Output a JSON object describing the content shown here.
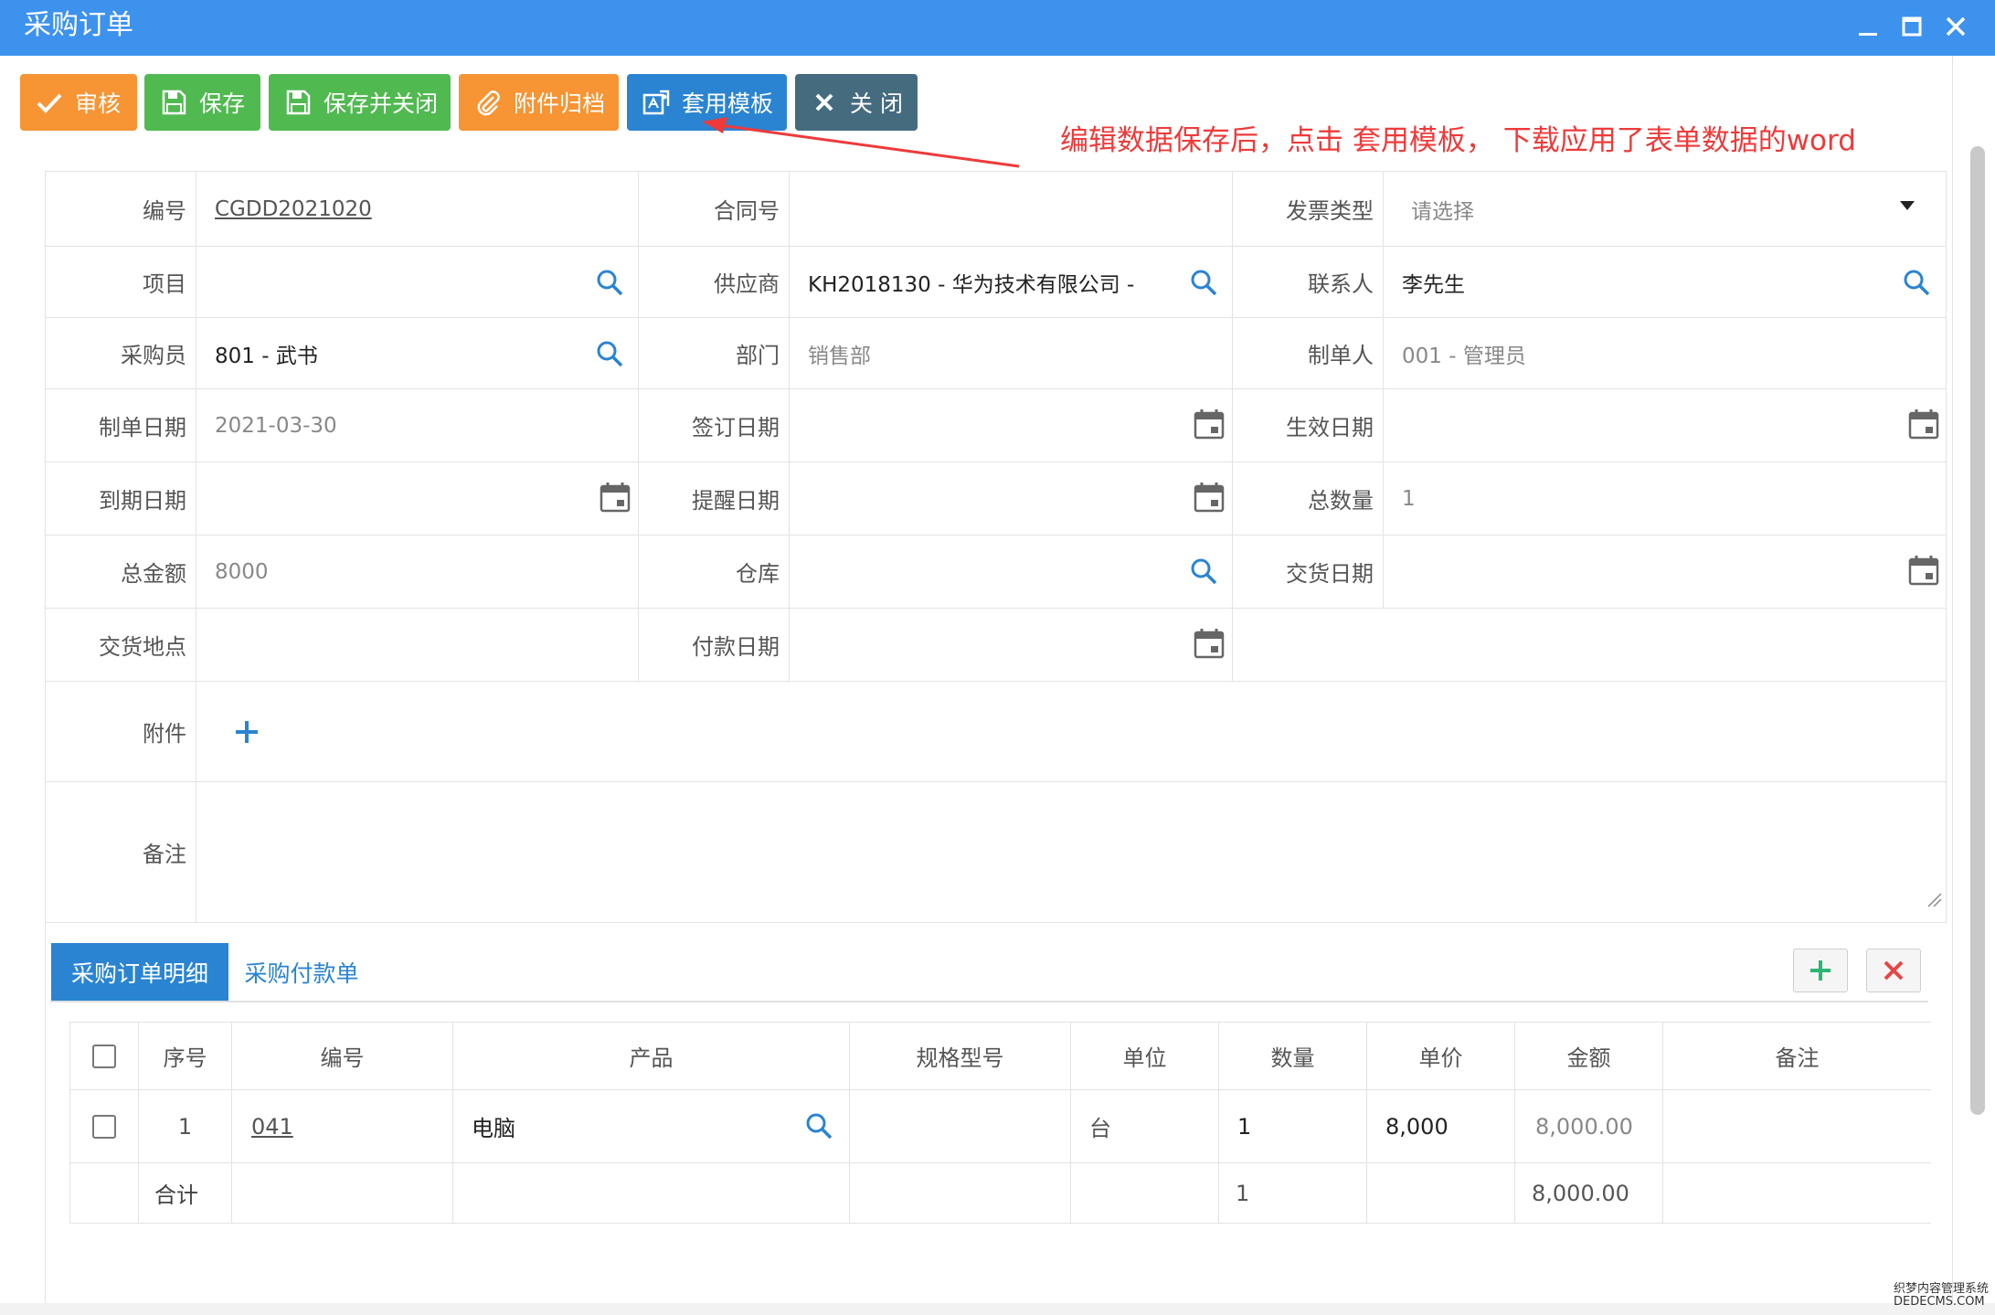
{
  "window": {
    "title": "采购订单"
  },
  "toolbar": {
    "approve": "审核",
    "save": "保存",
    "save_close": "保存并关闭",
    "attach_archive": "附件归档",
    "apply_template": "套用模板",
    "close": "关 闭"
  },
  "annotation": "编辑数据保存后，点击 套用模板， 下载应用了表单数据的word",
  "form": {
    "code_label": "编号",
    "code_value": "CGDD2021020",
    "contract_label": "合同号",
    "contract_value": "",
    "invoice_label": "发票类型",
    "invoice_placeholder": "请选择",
    "project_label": "项目",
    "project_value": "",
    "supplier_label": "供应商",
    "supplier_value": "KH2018130 - 华为技术有限公司 -",
    "contact_label": "联系人",
    "contact_value": "李先生",
    "buyer_label": "采购员",
    "buyer_value": "801 - 武书",
    "dept_label": "部门",
    "dept_value": "销售部",
    "maker_label": "制单人",
    "maker_value": "001 - 管理员",
    "make_date_label": "制单日期",
    "make_date_value": "2021-03-30",
    "sign_date_label": "签订日期",
    "sign_date_value": "",
    "effective_date_label": "生效日期",
    "effective_date_value": "",
    "due_date_label": "到期日期",
    "due_date_value": "",
    "remind_date_label": "提醒日期",
    "remind_date_value": "",
    "total_qty_label": "总数量",
    "total_qty_value": "1",
    "total_amount_label": "总金额",
    "total_amount_value": "8000",
    "warehouse_label": "仓库",
    "warehouse_value": "",
    "delivery_date_label": "交货日期",
    "delivery_date_value": "",
    "delivery_place_label": "交货地点",
    "delivery_place_value": "",
    "pay_date_label": "付款日期",
    "pay_date_value": "",
    "attachment_label": "附件",
    "remark_label": "备注",
    "remark_value": ""
  },
  "tabs": [
    {
      "label": "采购订单明细",
      "active": true
    },
    {
      "label": "采购付款单",
      "active": false
    }
  ],
  "table": {
    "headers": [
      "序号",
      "编号",
      "产品",
      "规格型号",
      "单位",
      "数量",
      "单价",
      "金额",
      "备注"
    ],
    "rows": [
      {
        "seq": "1",
        "code": "041",
        "product": "电脑",
        "spec": "",
        "unit": "台",
        "qty": "1",
        "price": "8,000",
        "amount": "8,000.00",
        "remark": ""
      }
    ],
    "total": {
      "label": "合计",
      "qty": "1",
      "amount": "8,000.00"
    }
  },
  "watermark": {
    "line1": "织梦内容管理系统",
    "line2": "DEDECMS.COM"
  },
  "colors": {
    "titlebar": "#3d92ee",
    "orange": "#f79433",
    "green": "#50b950",
    "blue": "#2a84d2",
    "slate": "#456b7f",
    "annotation": "#ee3a3a",
    "search_icon": "#2a84d2"
  }
}
